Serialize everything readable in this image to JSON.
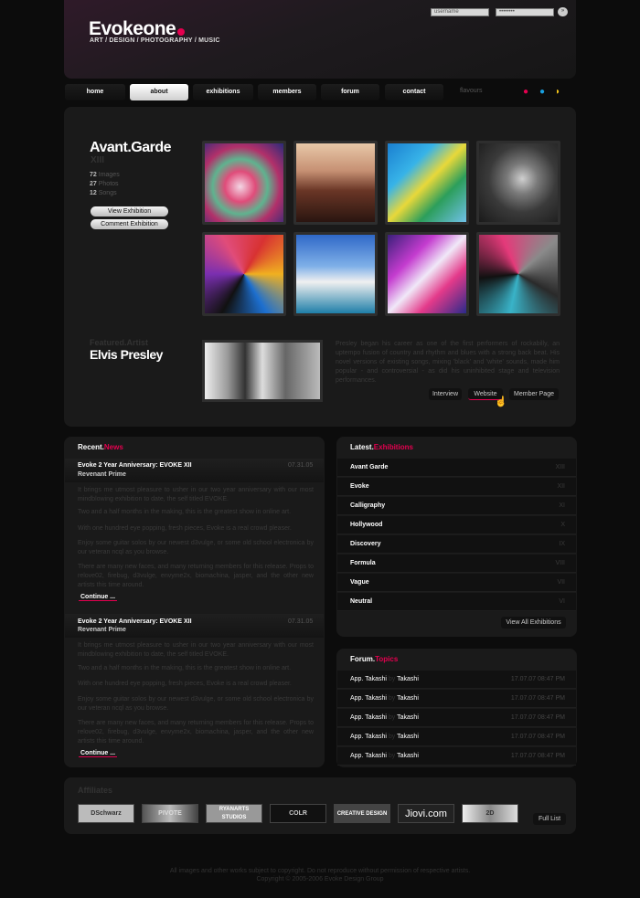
{
  "header": {
    "logo": "Evokeone",
    "tagline": "ART / DESIGN / PHOTOGRAPHY / MUSIC",
    "username_placeholder": "username",
    "password_value": "••••••••",
    "go": "»"
  },
  "nav": {
    "items": [
      "home",
      "about",
      "exhibitions",
      "members",
      "forum",
      "contact"
    ],
    "active": "about",
    "favours_label": "flavours",
    "favour_icons": [
      "strawberry-icon",
      "water-drop-icon",
      "banana-icon"
    ]
  },
  "exhibition": {
    "title": "Avant.Garde",
    "number": "XIII",
    "stats": [
      {
        "count": "72",
        "label": "Images"
      },
      {
        "count": "27",
        "label": "Photos"
      },
      {
        "count": "12",
        "label": "Songs"
      }
    ],
    "view_button": "View Exhibition",
    "comment_button": "Comment Exhibition"
  },
  "featured": {
    "label": "Featured.Artist",
    "name": "Elvis Presley",
    "bio": "Presley began his career as one of the first performers of rockabilly, an uptempo fusion of country and rhythm and blues with a strong back beat. His novel versions of existing songs, mixing 'black' and 'white' sounds, made him popular - and controversial - as did his uninhibited stage and television performances.",
    "buttons": [
      "Interview",
      "Website",
      "Member Page"
    ]
  },
  "news": {
    "title_a": "Recent.",
    "title_b": "News",
    "items": [
      {
        "title": "Evoke 2 Year Anniversary: EVOKE XII",
        "author": "Revenant Prime",
        "date": "07.31.05",
        "p1": "It brings me utmost pleasure to usher in our two year anniversary with our most mindblowing exhibition to date, the self titled EVOKE.",
        "p2": "Two and a half months in the making, this is the greatest show in online art.",
        "p3": "With one hundred eye popping, fresh pieces, Evoke is a real crowd pleaser.",
        "p4": "Enjoy some guitar solos by our newest d3vulge, or some old school electronica by our veteran ncql as you browse.",
        "p5": "There are many new faces, and many returning members for this release. Props to relove02, firebug, d3vulge, envyme2x, biomachina, jasper, and the other new artists this time around.",
        "more": "Continue ..."
      },
      {
        "title": "Evoke 2 Year Anniversary: EVOKE XII",
        "author": "Revenant Prime",
        "date": "07.31.05",
        "p1": "It brings me utmost pleasure to usher in our two year anniversary with our most mindblowing exhibition to date, the self titled EVOKE.",
        "p2": "Two and a half months in the making, this is the greatest show in online art.",
        "p3": "With one hundred eye popping, fresh pieces, Evoke is a real crowd pleaser.",
        "p4": "Enjoy some guitar solos by our newest d3vulge, or some old school electronica by our veteran ncql as you browse.",
        "p5": "There are many new faces, and many returning members for this release. Props to relove02, firebug, d3vulge, envyme2x, biomachina, jasper, and the other new artists this time around.",
        "more": "Continue ..."
      }
    ]
  },
  "exhibitions": {
    "title_a": "Latest.",
    "title_b": "Exhibitions",
    "items": [
      {
        "name": "Avant Garde",
        "num": "XIII"
      },
      {
        "name": "Evoke",
        "num": "XII"
      },
      {
        "name": "Calligraphy",
        "num": "XI"
      },
      {
        "name": "Hollywood",
        "num": "X"
      },
      {
        "name": "Discovery",
        "num": "IX"
      },
      {
        "name": "Formula",
        "num": "VIII"
      },
      {
        "name": "Vague",
        "num": "VII"
      },
      {
        "name": "Neutral",
        "num": "VI"
      }
    ],
    "view_all": "View All Exhibitions"
  },
  "forum": {
    "title_a": "Forum.",
    "title_b": "Topics",
    "items": [
      {
        "topic": "App. Takashi",
        "by": "by",
        "user": "Takashi",
        "date": "17.07.07 08:47 PM"
      },
      {
        "topic": "App. Takashi",
        "by": "by",
        "user": "Takashi",
        "date": "17.07.07 08:47 PM"
      },
      {
        "topic": "App. Takashi",
        "by": "by",
        "user": "Takashi",
        "date": "17.07.07 08:47 PM"
      },
      {
        "topic": "App. Takashi",
        "by": "by",
        "user": "Takashi",
        "date": "17.07.07 08:47 PM"
      },
      {
        "topic": "App. Takashi",
        "by": "by",
        "user": "Takashi",
        "date": "17.07.07 08:47 PM"
      }
    ]
  },
  "affiliates": {
    "title": "Affiliates",
    "logos": [
      "DSchwarz",
      "PIVOTE",
      "RYANARTS STUDIOS",
      "COLR",
      "CREATIVE DESIGN",
      "Jiovi.com",
      "2D"
    ],
    "full_list": "Full List"
  },
  "footer": {
    "line1": "All images and other works subject to copyright. Do not reproduce without permission of respective artists.",
    "line2": "Copyright © 2005-2006 Evoke Design Group"
  },
  "colors": {
    "accent": "#e4004f",
    "background": "#0c0c0c",
    "panel": "#1a1a1a"
  }
}
